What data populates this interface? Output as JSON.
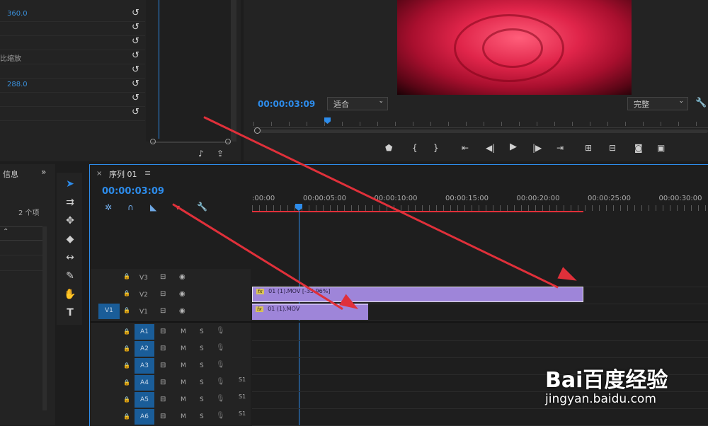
{
  "effect_controls": {
    "rows": [
      {
        "value": "360.0",
        "label": ""
      },
      {
        "value": "",
        "label": ""
      },
      {
        "value": "",
        "label": ""
      },
      {
        "value": "",
        "label": "比缩放"
      },
      {
        "value": "",
        "label": ""
      },
      {
        "value": "288.0",
        "label": ""
      },
      {
        "value": "",
        "label": ""
      },
      {
        "value": "",
        "label": ""
      }
    ]
  },
  "program_monitor": {
    "timecode": "00:00:03:09",
    "fit_label": "适合",
    "quality_label": "完整"
  },
  "project_panel": {
    "tab_label": "信息",
    "item_count": "2 个项"
  },
  "sequence": {
    "tab_label": "序列 01",
    "timecode": "00:00:03:09",
    "ruler_labels": [
      ":00:00",
      "00:00:05:00",
      "00:00:10:00",
      "00:00:15:00",
      "00:00:20:00",
      "00:00:25:00",
      "00:00:30:00"
    ],
    "video_tracks": [
      {
        "name": "V3",
        "source": ""
      },
      {
        "name": "V2",
        "source": "V1"
      },
      {
        "name": "V1",
        "source": ""
      }
    ],
    "audio_tracks": [
      "A1",
      "A2",
      "A3",
      "A4",
      "A5",
      "A6"
    ],
    "track_letters": {
      "mute": "M",
      "solo": "S"
    },
    "audio_side_labels": [
      "S1",
      "S1",
      "S1"
    ],
    "clips": [
      {
        "track": "V2",
        "label": "01 (1).MOV [-35.96%]",
        "fx": "fx"
      },
      {
        "track": "V1",
        "label": "01 (1).MOV",
        "fx": "fx"
      }
    ]
  },
  "watermark": {
    "brand": "Bai百度经验",
    "url": "jingyan.baidu.com"
  },
  "colors": {
    "accent_blue": "#2d8ceb",
    "clip_purple": "#9e85d9",
    "annotation_red": "#e0303a"
  }
}
